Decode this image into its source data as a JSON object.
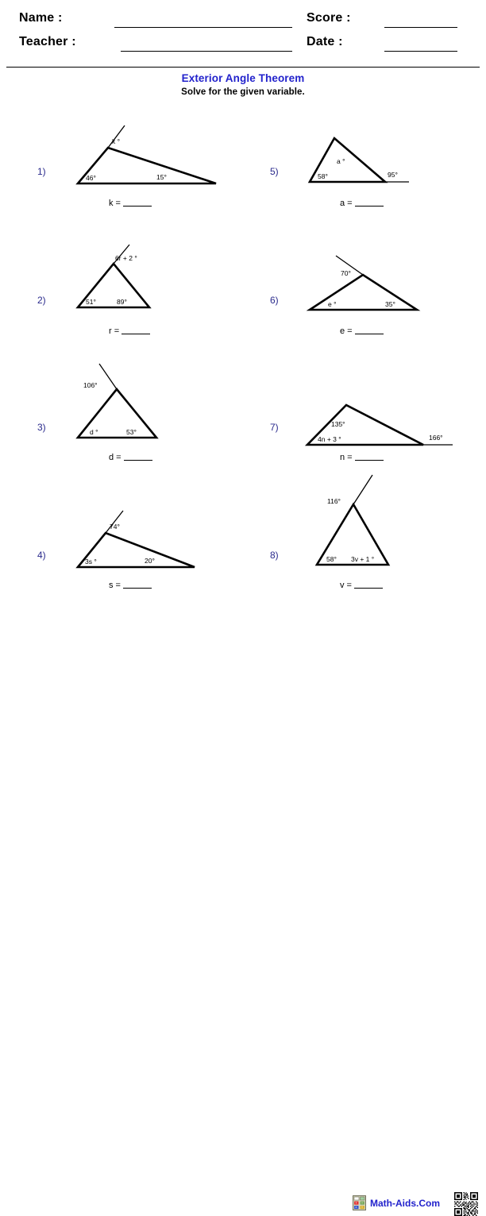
{
  "header": {
    "name_label": "Name :",
    "teacher_label": "Teacher :",
    "score_label": "Score :",
    "date_label": "Date :",
    "name_value": "",
    "teacher_value": "",
    "score_value": "",
    "date_value": ""
  },
  "title": "Exterior Angle Theorem",
  "subtitle": "Solve for the given variable.",
  "problems": [
    {
      "number": "1)",
      "shape": "triangle-with-exterior-ray",
      "labels": {
        "exterior": "k °",
        "left": "46°",
        "right": "15°"
      },
      "answer_prefix": "k ="
    },
    {
      "number": "2)",
      "shape": "triangle-with-exterior-ray",
      "labels": {
        "exterior": "6r + 2 °",
        "left": "51°",
        "right": "89°"
      },
      "answer_prefix": "r ="
    },
    {
      "number": "3)",
      "shape": "triangle-with-exterior-ray",
      "labels": {
        "exterior": "106°",
        "left": "d °",
        "right": "53°"
      },
      "answer_prefix": "d ="
    },
    {
      "number": "4)",
      "shape": "triangle-with-exterior-ray",
      "labels": {
        "exterior": "74°",
        "left": "3s °",
        "right": "20°"
      },
      "answer_prefix": "s ="
    },
    {
      "number": "5)",
      "shape": "triangle-with-base-extension",
      "labels": {
        "apex": "a °",
        "left": "58°",
        "exterior": "95°"
      },
      "answer_prefix": "a ="
    },
    {
      "number": "6)",
      "shape": "triangle-with-exterior-ray",
      "labels": {
        "exterior": "70°",
        "left": "e °",
        "right": "35°"
      },
      "answer_prefix": "e ="
    },
    {
      "number": "7)",
      "shape": "triangle-with-base-extension",
      "labels": {
        "apex": "135°",
        "left": "4n + 3 °",
        "exterior": "166°"
      },
      "answer_prefix": "n ="
    },
    {
      "number": "8)",
      "shape": "triangle-with-exterior-ray",
      "labels": {
        "exterior": "116°",
        "left": "58°",
        "right": "3v + 1 °"
      },
      "answer_prefix": "v ="
    }
  ],
  "footer": {
    "brand": "Math-Aids.Com",
    "calculator_icon": "calculator-icon",
    "qr_icon": "qr-code-icon"
  },
  "colors": {
    "title_blue": "#2222cc",
    "number_blue": "#2a2a8c",
    "ink": "#000000",
    "paper": "#ffffff"
  }
}
